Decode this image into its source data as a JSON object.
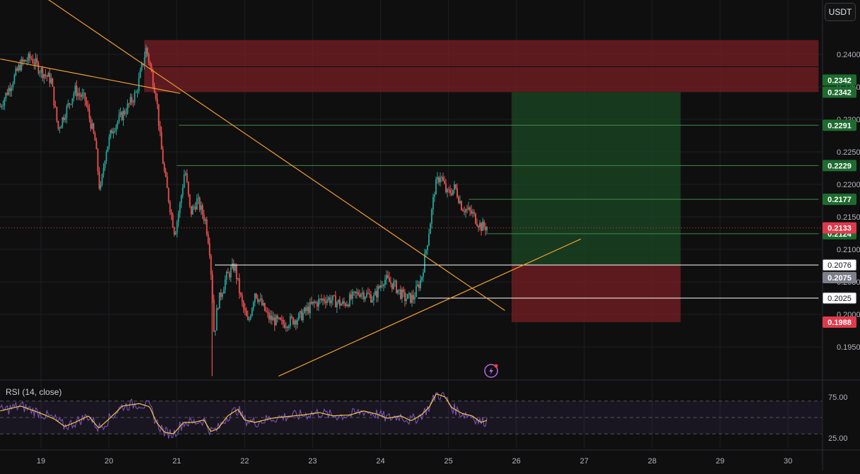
{
  "header": {
    "currency": "USDT"
  },
  "chart_data": [
    {
      "type": "candlestick",
      "pair_quote": "USDT",
      "x_ticks": [
        "19",
        "20",
        "21",
        "22",
        "23",
        "24",
        "25",
        "26",
        "27",
        "28",
        "29",
        "30"
      ],
      "x_range_days": [
        18.4,
        30.5
      ],
      "y_range": [
        0.191,
        0.2475
      ],
      "price_ticks": [
        0.24,
        0.235,
        0.23,
        0.225,
        0.22,
        0.215,
        0.21,
        0.205,
        0.2,
        0.195
      ],
      "price_tick_labels": [
        "0.2400",
        "0.2350",
        "0.2300",
        "0.2250",
        "0.2200",
        "0.2150",
        "0.2100",
        "0.2050",
        "0.2000",
        "0.1950"
      ],
      "price_path": [
        [
          18.4,
          0.232
        ],
        [
          18.7,
          0.2385
        ],
        [
          18.85,
          0.2395
        ],
        [
          19.0,
          0.2375
        ],
        [
          19.15,
          0.236
        ],
        [
          19.25,
          0.2285
        ],
        [
          19.5,
          0.2345
        ],
        [
          19.65,
          0.233
        ],
        [
          19.8,
          0.2265
        ],
        [
          19.87,
          0.2185
        ],
        [
          19.95,
          0.225
        ],
        [
          20.05,
          0.2285
        ],
        [
          20.25,
          0.2315
        ],
        [
          20.4,
          0.234
        ],
        [
          20.55,
          0.241
        ],
        [
          20.62,
          0.2375
        ],
        [
          20.7,
          0.2335
        ],
        [
          20.76,
          0.2265
        ],
        [
          20.82,
          0.2215
        ],
        [
          20.9,
          0.2165
        ],
        [
          20.97,
          0.2125
        ],
        [
          21.05,
          0.217
        ],
        [
          21.12,
          0.2225
        ],
        [
          21.2,
          0.2155
        ],
        [
          21.3,
          0.2175
        ],
        [
          21.42,
          0.2145
        ],
        [
          21.48,
          0.2105
        ],
        [
          21.52,
          0.204
        ],
        [
          21.55,
          0.1965
        ],
        [
          21.6,
          0.2015
        ],
        [
          21.72,
          0.2055
        ],
        [
          21.85,
          0.2075
        ],
        [
          21.95,
          0.202
        ],
        [
          22.05,
          0.1985
        ],
        [
          22.15,
          0.2035
        ],
        [
          22.35,
          0.1995
        ],
        [
          22.55,
          0.1985
        ],
        [
          22.8,
          0.1995
        ],
        [
          23.0,
          0.2015
        ],
        [
          23.2,
          0.2025
        ],
        [
          23.45,
          0.2015
        ],
        [
          23.7,
          0.2035
        ],
        [
          23.9,
          0.2025
        ],
        [
          24.05,
          0.2055
        ],
        [
          24.2,
          0.2045
        ],
        [
          24.35,
          0.2025
        ],
        [
          24.48,
          0.2025
        ],
        [
          24.6,
          0.2055
        ],
        [
          24.68,
          0.2105
        ],
        [
          24.75,
          0.2155
        ],
        [
          24.8,
          0.2195
        ],
        [
          24.88,
          0.2215
        ],
        [
          24.98,
          0.2185
        ],
        [
          25.1,
          0.2195
        ],
        [
          25.2,
          0.2165
        ],
        [
          25.35,
          0.2155
        ],
        [
          25.48,
          0.2135
        ],
        [
          25.58,
          0.2135
        ]
      ],
      "price_levels": [
        {
          "value": 0.2342,
          "label": "0.2342",
          "color": "#1e6b2f",
          "line": "#3e8a4a"
        },
        {
          "value": 0.2342,
          "label": "0.2342",
          "color": "#1e6b2f",
          "line": "#3e8a4a"
        },
        {
          "value": 0.2291,
          "label": "0.2291",
          "color": "#1e6b2f",
          "line": "#3e8a4a"
        },
        {
          "value": 0.2229,
          "label": "0.2229",
          "color": "#1e6b2f",
          "line": "#3e8a4a"
        },
        {
          "value": 0.2177,
          "label": "0.2177",
          "color": "#1e6b2f",
          "line": "#3e8a4a"
        },
        {
          "value": 0.2124,
          "label": "0.2124",
          "color": "#1e6b2f",
          "line": "#3e8a4a"
        },
        {
          "value": 0.2076,
          "label": "0.2076",
          "color": "#ffffff",
          "line": "#ffffff"
        },
        {
          "value": 0.2075,
          "label": "0.2075",
          "color": "#7d808a",
          "line": "#7d808a"
        },
        {
          "value": 0.2025,
          "label": "0.2025",
          "color": "#ffffff",
          "line": "#ffffff"
        },
        {
          "value": 0.1988,
          "label": "0.1988",
          "color": "#e0394b",
          "line": "#e0394b"
        }
      ],
      "current_price": {
        "value": 0.2133,
        "label": "0.2133",
        "color": "#e0394b"
      },
      "zones": [
        {
          "name": "resistance",
          "x0": 20.52,
          "x1": 30.45,
          "y0": 0.2342,
          "y1": 0.2422,
          "color": "#7a1f26"
        },
        {
          "name": "take-profit",
          "x0": 25.93,
          "x1": 28.42,
          "y0": 0.2076,
          "y1": 0.2342,
          "color": "#1a4a24"
        },
        {
          "name": "stop-loss",
          "x0": 25.93,
          "x1": 28.42,
          "y0": 0.1988,
          "y1": 0.2076,
          "color": "#7a1f26"
        }
      ],
      "resistance_midline": 0.2381,
      "trendlines": [
        {
          "x0": 18.4,
          "y0": 0.2393,
          "x1": 21.05,
          "y1": 0.234,
          "color": "#f0a030"
        },
        {
          "x0": 19.0,
          "y0": 0.2492,
          "x1": 25.83,
          "y1": 0.2006,
          "color": "#f0a030"
        },
        {
          "x0": 22.5,
          "y0": 0.1905,
          "x1": 26.95,
          "y1": 0.2116,
          "color": "#f0a030"
        }
      ],
      "horizontal_segments": [
        {
          "x0": 21.56,
          "x1": 30.45,
          "y": 0.2076,
          "color": "#ffffff"
        },
        {
          "x0": 24.55,
          "x1": 30.45,
          "y": 0.2025,
          "color": "#ffffff"
        },
        {
          "x0": 21.03,
          "x1": 30.45,
          "y": 0.2291,
          "color": "#3e8a4a"
        },
        {
          "x0": 21.0,
          "x1": 30.45,
          "y": 0.2229,
          "color": "#3e8a4a"
        },
        {
          "x0": 25.3,
          "x1": 30.45,
          "y": 0.2177,
          "color": "#3e8a4a"
        },
        {
          "x0": 25.55,
          "x1": 30.45,
          "y": 0.2124,
          "color": "#3e8a4a"
        }
      ]
    },
    {
      "type": "line",
      "title": "RSI (14, close)",
      "y_ticks": [
        75,
        25
      ],
      "y_tick_labels": [
        "75.00",
        "25.00"
      ],
      "y_range": [
        20,
        85
      ],
      "band": [
        70,
        30
      ],
      "midline": 50,
      "rsi_path": [
        [
          18.4,
          58
        ],
        [
          18.7,
          64
        ],
        [
          19.0,
          55
        ],
        [
          19.2,
          48
        ],
        [
          19.35,
          39
        ],
        [
          19.5,
          44
        ],
        [
          19.7,
          52
        ],
        [
          19.85,
          37
        ],
        [
          20.0,
          48
        ],
        [
          20.2,
          64
        ],
        [
          20.45,
          67
        ],
        [
          20.6,
          63
        ],
        [
          20.7,
          44
        ],
        [
          20.82,
          32
        ],
        [
          20.95,
          30
        ],
        [
          21.1,
          44
        ],
        [
          21.25,
          44
        ],
        [
          21.4,
          47
        ],
        [
          21.5,
          33
        ],
        [
          21.6,
          36
        ],
        [
          21.75,
          52
        ],
        [
          21.9,
          60
        ],
        [
          22.0,
          47
        ],
        [
          22.15,
          44
        ],
        [
          22.4,
          49
        ],
        [
          22.6,
          51
        ],
        [
          22.85,
          53
        ],
        [
          23.1,
          56
        ],
        [
          23.3,
          52
        ],
        [
          23.55,
          53
        ],
        [
          23.75,
          58
        ],
        [
          23.95,
          54
        ],
        [
          24.1,
          49
        ],
        [
          24.3,
          52
        ],
        [
          24.45,
          46
        ],
        [
          24.6,
          53
        ],
        [
          24.72,
          63
        ],
        [
          24.82,
          79
        ],
        [
          24.95,
          75
        ],
        [
          25.05,
          62
        ],
        [
          25.2,
          55
        ],
        [
          25.35,
          52
        ],
        [
          25.48,
          44
        ],
        [
          25.58,
          47
        ]
      ]
    }
  ]
}
